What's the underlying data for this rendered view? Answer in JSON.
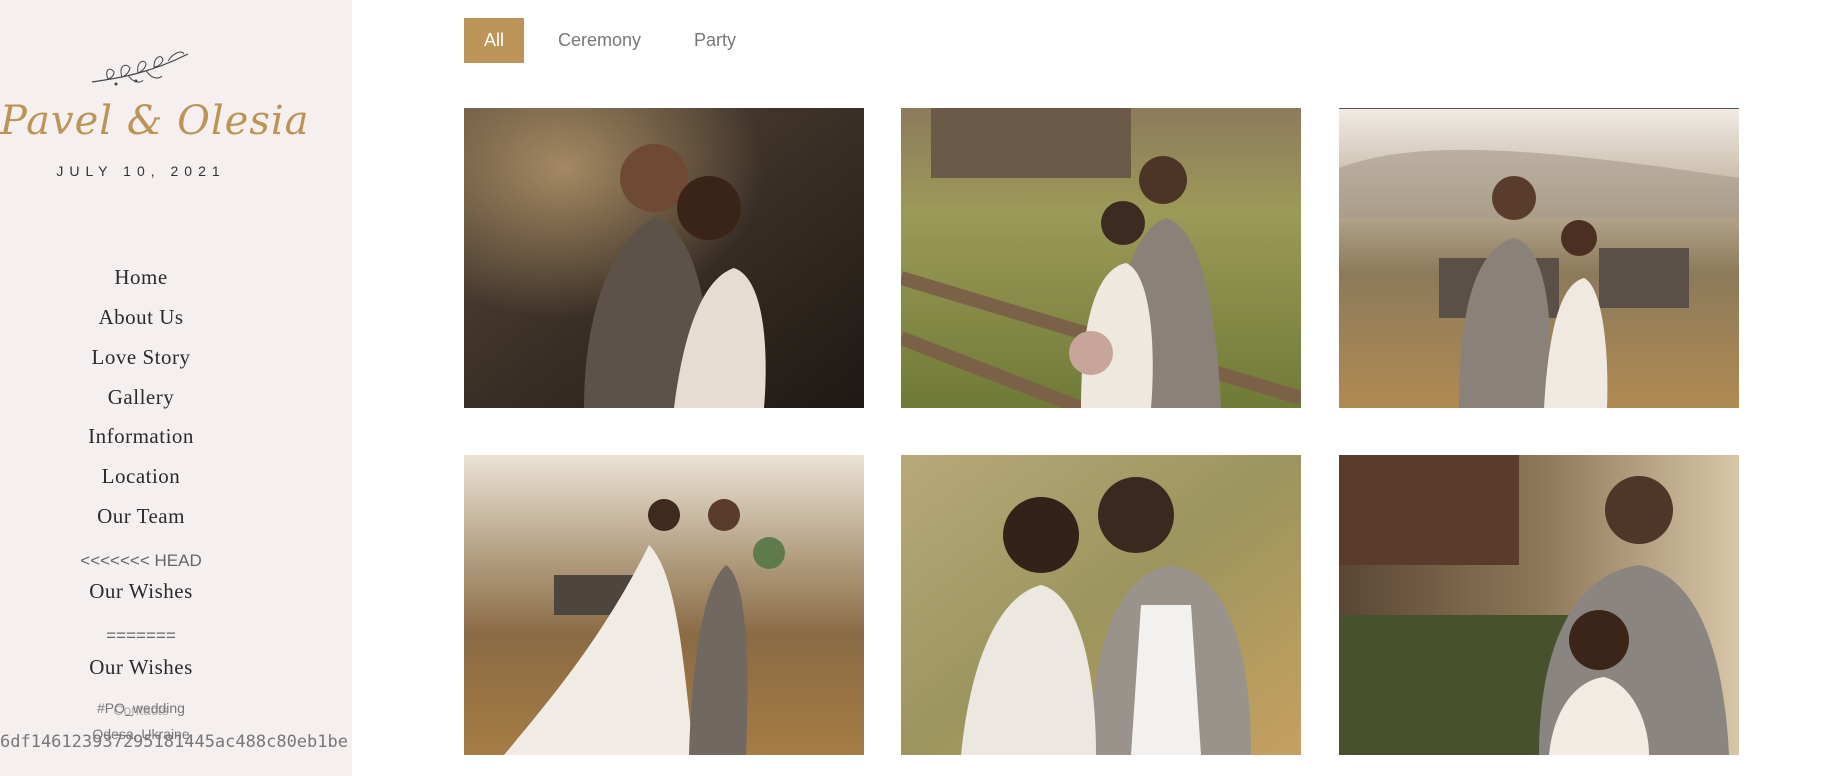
{
  "sidebar": {
    "couple_name": "Pavel & Olesia",
    "date": "JULY 10, 2021",
    "nav": {
      "home": "Home",
      "about": "About Us",
      "love_story": "Love Story",
      "gallery": "Gallery",
      "information": "Information",
      "location": "Location",
      "team": "Our Team",
      "merge_head": "<<<<<<< HEAD",
      "wishes_a": "Our Wishes",
      "merge_sep": "=======",
      "wishes_b": "Our Wishes"
    },
    "hashtag": "#PO_wedding",
    "overlap_word": "Contacts",
    "location": "Odesa, Ukraine",
    "merge_hash": "6df1461239372951814​45ac488c80eb1be"
  },
  "filters": {
    "all": "All",
    "ceremony": "Ceremony",
    "party": "Party"
  },
  "gallery": {
    "photos": [
      {
        "name": "couple kissing at sunset"
      },
      {
        "name": "couple by wooden fence"
      },
      {
        "name": "couple standing in field"
      },
      {
        "name": "couple walking hand in hand"
      },
      {
        "name": "couple nose to nose"
      },
      {
        "name": "couple at barn"
      }
    ]
  },
  "colors": {
    "accent": "#bd9457",
    "sidebar_bg": "#f5f0ef"
  }
}
